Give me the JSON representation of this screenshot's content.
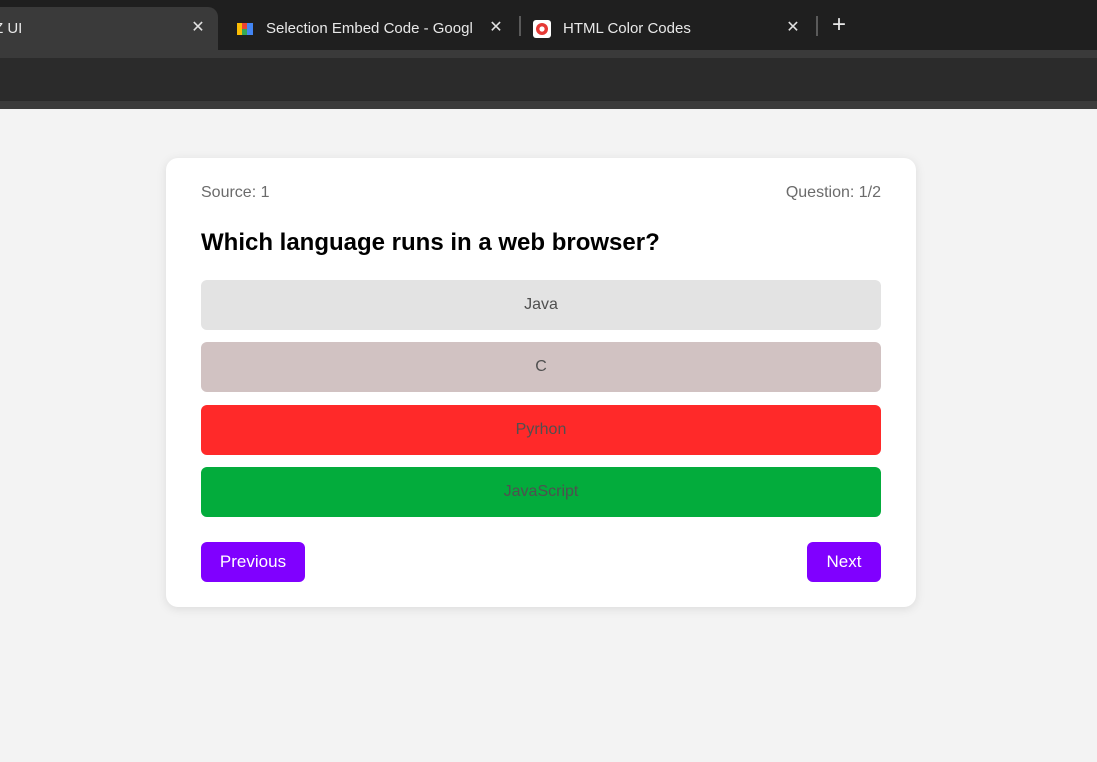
{
  "browser": {
    "tabs": [
      {
        "title": "Z UI",
        "favicon": "app-icon",
        "active": true
      },
      {
        "title": "Selection Embed Code - Googl",
        "favicon": "google-sites-icon",
        "active": false
      },
      {
        "title": "HTML Color Codes",
        "favicon": "color-picker-icon",
        "active": false
      }
    ],
    "close_glyph": "✕",
    "new_tab_glyph": "+"
  },
  "quiz": {
    "source_label": "Source: 1",
    "progress_label": "Question: 1/2",
    "question": "Which language runs in a web browser?",
    "options": [
      {
        "label": "Java",
        "color": "#e3e3e3"
      },
      {
        "label": "C",
        "color": "#d1c2c2"
      },
      {
        "label": "Pyrhon",
        "color": "#ff2929"
      },
      {
        "label": "JavaScript",
        "color": "#03ac3c"
      }
    ],
    "previous_label": "Previous",
    "next_label": "Next",
    "accent_color": "#8000ff"
  }
}
